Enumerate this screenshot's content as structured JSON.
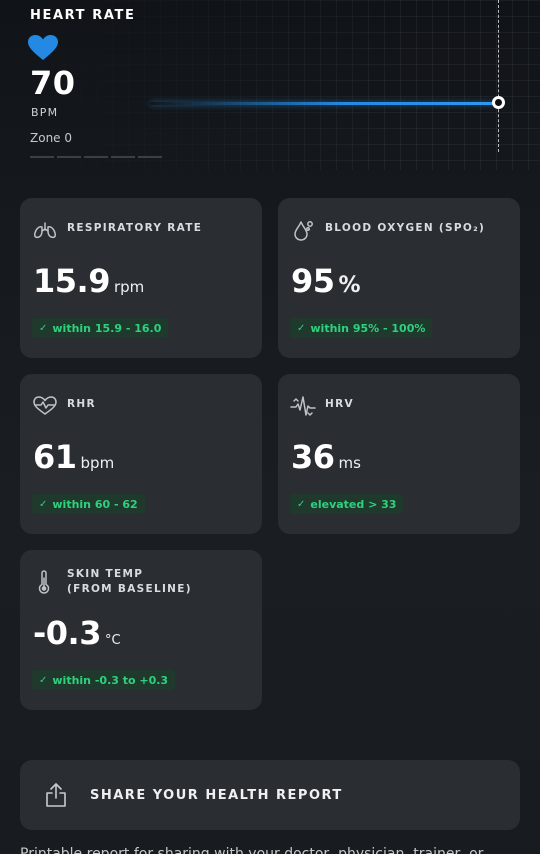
{
  "heart_rate": {
    "title": "HEART RATE",
    "value": "70",
    "unit": "BPM",
    "zone": "Zone 0",
    "accent_color": "#2389e2"
  },
  "metrics": [
    {
      "icon": "lungs-icon",
      "label": "RESPIRATORY RATE",
      "value": "15.9",
      "unit": "rpm",
      "range": "within 15.9 - 16.0"
    },
    {
      "icon": "droplet-icon",
      "label": "BLOOD OXYGEN (SPO₂)",
      "value": "95",
      "unit": "%",
      "range": "within 95% - 100%"
    },
    {
      "icon": "heart-wave-icon",
      "label": "RHR",
      "value": "61",
      "unit": "bpm",
      "range": "within 60 - 62"
    },
    {
      "icon": "pulse-icon",
      "label": "HRV",
      "value": "36",
      "unit": "ms",
      "range": "elevated > 33"
    },
    {
      "icon": "thermometer-icon",
      "label_line1": "SKIN TEMP",
      "label_line2": "(FROM BASELINE)",
      "value": "-0.3",
      "unit": "°C",
      "range": "within -0.3 to +0.3"
    }
  ],
  "share": {
    "icon": "share-icon",
    "label": "SHARE YOUR HEALTH REPORT",
    "description": "Printable report for sharing with your doctor, physician, trainer, or"
  },
  "colors": {
    "badge_text": "#2fd17f",
    "badge_bg": "#1f3a2d",
    "card_bg": "#2a2e33"
  }
}
